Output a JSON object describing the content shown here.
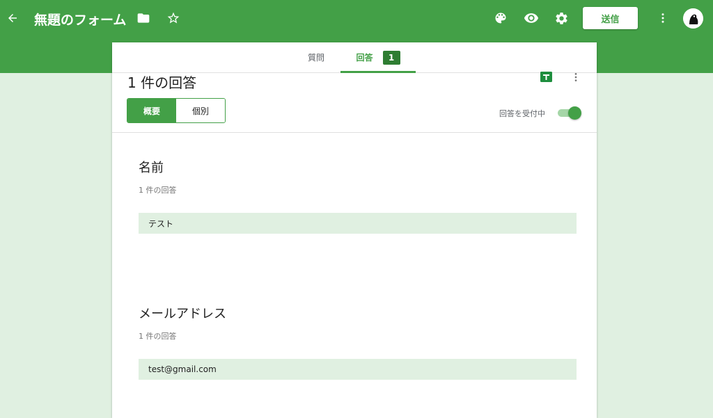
{
  "header": {
    "form_title": "無題のフォーム",
    "send_label": "送信",
    "icons": [
      "arrow-back-icon",
      "folder-icon",
      "star-icon",
      "palette-icon",
      "eye-icon",
      "gear-icon",
      "more-vert-icon",
      "avatar"
    ]
  },
  "tabs": {
    "questions_label": "質問",
    "responses_label": "回答",
    "responses_count": "1"
  },
  "summary": {
    "title": "1 件の回答",
    "segment_summary": "概要",
    "segment_individual": "個別",
    "accepting_label": "回答を受付中",
    "accepting_on": true
  },
  "questions": [
    {
      "title": "名前",
      "count_label": "1 件の回答",
      "answers": [
        "テスト"
      ]
    },
    {
      "title": "メールアドレス",
      "count_label": "1 件の回答",
      "answers": [
        "test@gmail.com"
      ]
    }
  ],
  "colors": {
    "primary": "#43a047",
    "badge": "#2e7d32",
    "background": "#e0f0e1",
    "answer_bg": "#e0f0e1"
  }
}
